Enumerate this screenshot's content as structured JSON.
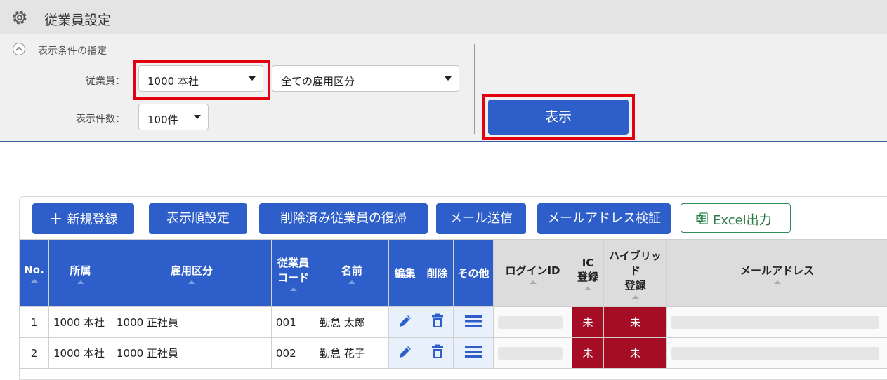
{
  "header": {
    "title": "従業員設定",
    "icon": "gear-icon"
  },
  "filter": {
    "section_label": "表示条件の指定",
    "employee_label": "従業員：",
    "employee_value": "1000 本社",
    "employment_type_value": "全ての雇用区分",
    "count_label": "表示件数：",
    "count_value": "100件",
    "show_button": "表示"
  },
  "toolbar": {
    "new_button": "新規登録",
    "order_button": "表示順設定",
    "restore_button": "削除済み従業員の復帰",
    "mail_button": "メール送信",
    "verify_button": "メールアドレス検証",
    "excel_button": "Excel出力"
  },
  "table": {
    "headers": {
      "no": "No.",
      "dept": "所属",
      "type": "雇用区分",
      "code_1": "従業員",
      "code_2": "コード",
      "name": "名前",
      "edit": "編集",
      "delete": "削除",
      "other": "その他",
      "login": "ログインID",
      "ic_1": "IC",
      "ic_2": "登録",
      "hybrid_1": "ハイブリッド",
      "hybrid_2": "登録",
      "mail": "メールアドレス"
    },
    "rows": [
      {
        "no": "1",
        "dept": "1000 本社",
        "type": "1000 正社員",
        "code": "001",
        "name": "勤怠 太郎",
        "ic": "未",
        "hybrid": "未"
      },
      {
        "no": "2",
        "dept": "1000 本社",
        "type": "1000 正社員",
        "code": "002",
        "name": "勤怠 花子",
        "ic": "未",
        "hybrid": "未"
      }
    ]
  },
  "colors": {
    "primary": "#2d5ec9",
    "highlight": "#e3000f",
    "ic_cell": "#a50d25",
    "excel_green": "#2e8b57"
  }
}
